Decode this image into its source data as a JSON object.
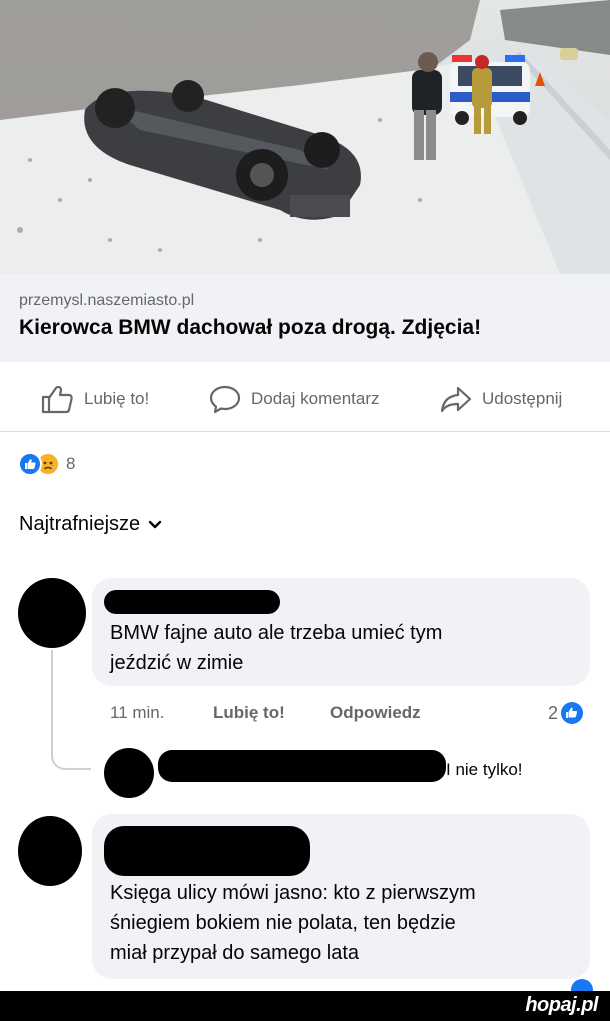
{
  "post": {
    "image_alt": "Overturned BMW in snowy roadside with police car",
    "link_domain": "przemysl.naszemiasto.pl",
    "link_title": "Kierowca BMW dachował poza drogą. Zdjęcia!"
  },
  "actions": {
    "like_label": "Lubię to!",
    "comment_label": "Dodaj komentarz",
    "share_label": "Udostępnij"
  },
  "reactions": {
    "count": "8",
    "types": [
      "like-icon",
      "sad-icon"
    ]
  },
  "sort": {
    "label": "Najtrafniejsze"
  },
  "comments": [
    {
      "text_line1": "BMW fajne auto ale trzeba umieć tym",
      "text_line2": "jeździć w zimie",
      "time": "11 min.",
      "like_label": "Lubię to!",
      "reply_label": "Odpowiedz",
      "like_count": "2"
    },
    {
      "reply_preview": "I nie tylko!"
    },
    {
      "text_line1": "Księga ulicy mówi jasno: kto z pierwszym",
      "text_line2": "śniegiem bokiem nie polata, ten będzie",
      "text_line3": "miał przypał do samego lata"
    }
  ],
  "watermark": "hopaj.pl",
  "colors": {
    "accent": "#1877f2",
    "bubble": "#f0f2f5",
    "muted_text": "#65676b"
  }
}
